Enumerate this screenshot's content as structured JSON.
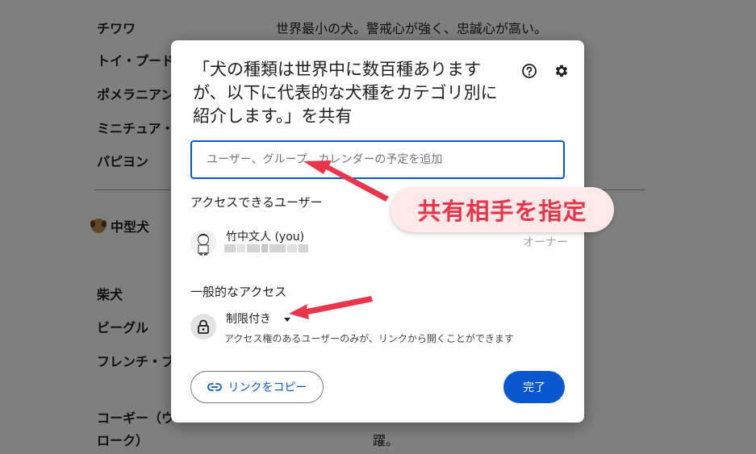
{
  "background": {
    "breeds_small": [
      {
        "name": "チワワ",
        "desc": "世界最小の犬。警戒心が強く、忠誠心が高い。"
      },
      {
        "name": "トイ・プード",
        "desc": ""
      },
      {
        "name": "ポメラニアン",
        "desc": ""
      },
      {
        "name": "ミニチュア・",
        "desc": ""
      },
      {
        "name": "パピヨン",
        "desc": ""
      }
    ],
    "section_title": "中型犬",
    "breeds_medium": [
      {
        "name": "柴犬",
        "desc": ""
      },
      {
        "name": "ビーグル",
        "desc": ""
      },
      {
        "name": "フレンチ・ブ",
        "desc": ""
      },
      {
        "name": "コーギー（ウ",
        "desc": ""
      },
      {
        "name": "ローク）",
        "desc": "躍。"
      }
    ]
  },
  "dialog": {
    "title": "「犬の種類は世界中に数百種ありますが、以下に代表的な犬種をカテゴリ別に紹介します。」を共有",
    "help_icon": "help-icon",
    "settings_icon": "gear-icon",
    "add_people_placeholder": "ユーザー、グループ、カレンダーの予定を追加",
    "people_with_access_title": "アクセスできるユーザー",
    "user": {
      "name": "竹中文人 (you)",
      "role": "オーナー"
    },
    "general_access_title": "一般的なアクセス",
    "general_access_value": "制限付き",
    "general_access_desc": "アクセス権のあるユーザーのみが、リンクから開くことができます",
    "copy_link_label": "リンクをコピー",
    "done_label": "完了"
  },
  "annotation": {
    "callout_text": "共有相手を指定",
    "color": "#e8354a"
  }
}
